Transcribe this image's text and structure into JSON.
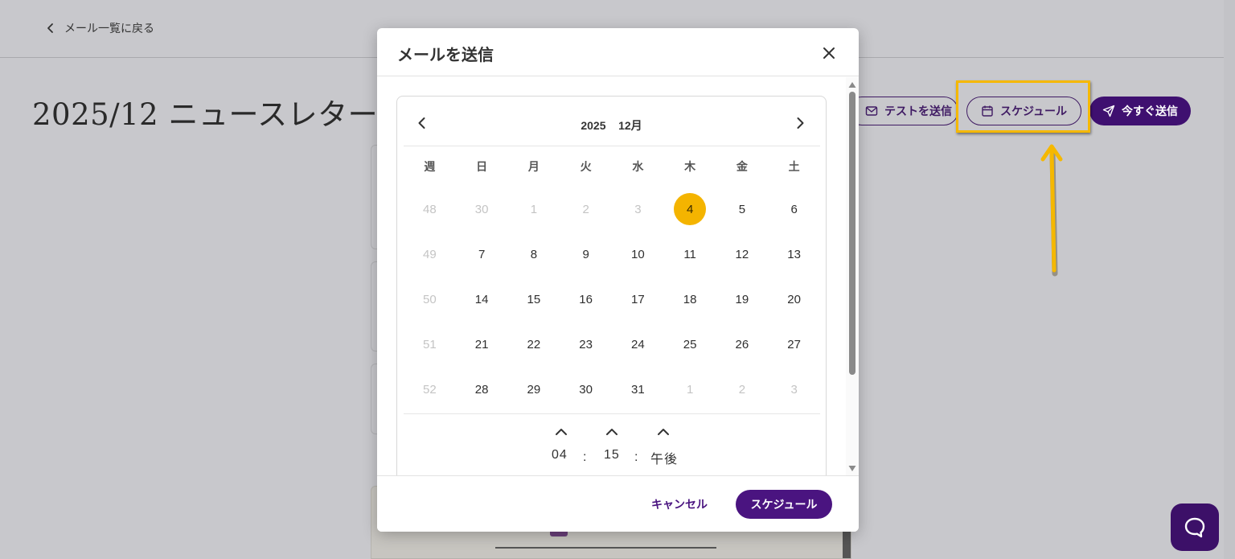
{
  "page": {
    "back_link": "メール一覧に戻る",
    "title": "2025/12 ニュースレター",
    "actions": {
      "test_label": "テストを送信",
      "schedule_label": "スケジュール",
      "send_now_label": "今すぐ送信"
    },
    "annotation_color": "#f5b800",
    "accent_color": "#3f1070"
  },
  "modal": {
    "title": "メールを送信",
    "calendar": {
      "year": "2025",
      "month": "12月",
      "header": "2025    12月",
      "weekdays": [
        "週",
        "日",
        "月",
        "火",
        "水",
        "木",
        "金",
        "土"
      ],
      "weeks": [
        {
          "week": "48",
          "days": [
            "30",
            "1",
            "2",
            "3",
            "4",
            "5",
            "6"
          ]
        },
        {
          "week": "49",
          "days": [
            "7",
            "8",
            "9",
            "10",
            "11",
            "12",
            "13"
          ]
        },
        {
          "week": "50",
          "days": [
            "14",
            "15",
            "16",
            "17",
            "18",
            "19",
            "20"
          ]
        },
        {
          "week": "51",
          "days": [
            "21",
            "22",
            "23",
            "24",
            "25",
            "26",
            "27"
          ]
        },
        {
          "week": "52",
          "days": [
            "28",
            "29",
            "30",
            "31",
            "1",
            "2",
            "3"
          ]
        }
      ],
      "selected_day": "4",
      "selected_color": "#f4b400"
    },
    "time": {
      "hour": "04",
      "minute": "15",
      "ampm": "午後",
      "separator": ":"
    },
    "footer": {
      "cancel_label": "キャンセル",
      "schedule_label": "スケジュール"
    }
  }
}
